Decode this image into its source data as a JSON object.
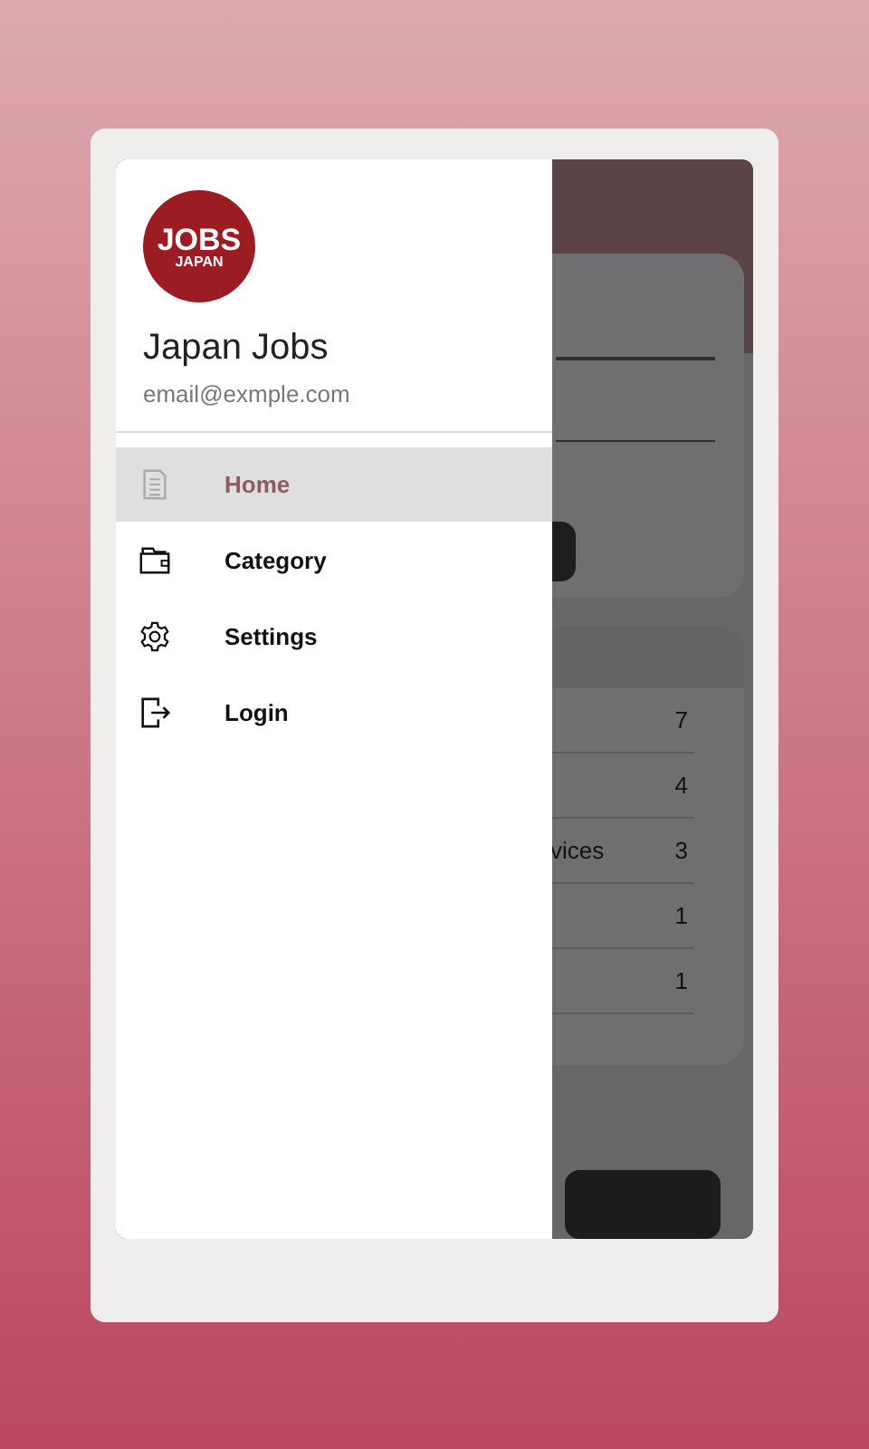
{
  "drawer": {
    "logo": {
      "line1": "JOBS",
      "line2": "JAPAN"
    },
    "title": "Japan Jobs",
    "email": "email@exmple.com",
    "items": [
      {
        "label": "Home",
        "kind": "home",
        "selected": true
      },
      {
        "label": "Category",
        "kind": "category",
        "selected": false
      },
      {
        "label": "Settings",
        "kind": "settings",
        "selected": false
      },
      {
        "label": "Login",
        "kind": "login",
        "selected": false
      }
    ]
  },
  "background": {
    "rows": [
      {
        "count": "7"
      },
      {
        "count": "4"
      },
      {
        "text": "vices",
        "count": "3"
      },
      {
        "count": "1"
      },
      {
        "count": "1"
      }
    ]
  }
}
